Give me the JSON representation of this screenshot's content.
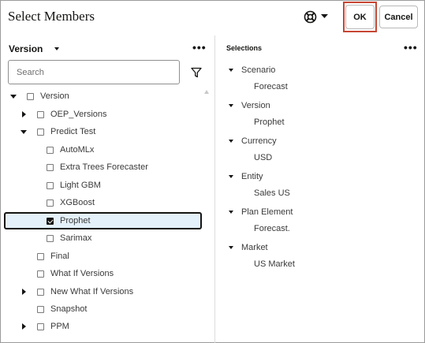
{
  "dialog": {
    "title": "Select Members",
    "ok_label": "OK",
    "cancel_label": "Cancel",
    "help_icon": "lifebuoy-icon",
    "help_caret_icon": "caret-down-icon"
  },
  "left": {
    "dimension_label": "Version",
    "more_label": "•••",
    "search_placeholder": "Search",
    "filter_icon": "filter-icon",
    "tree": [
      {
        "label": "Version",
        "toggle": "expanded",
        "checked": false
      },
      {
        "label": "OEP_Versions",
        "toggle": "collapsed",
        "checked": false
      },
      {
        "label": "Predict Test",
        "toggle": "expanded",
        "checked": false
      },
      {
        "label": "AutoMLx",
        "toggle": "none",
        "checked": false
      },
      {
        "label": "Extra Trees Forecaster",
        "toggle": "none",
        "checked": false
      },
      {
        "label": "Light GBM",
        "toggle": "none",
        "checked": false
      },
      {
        "label": "XGBoost",
        "toggle": "none",
        "checked": false
      },
      {
        "label": "Prophet",
        "toggle": "none",
        "checked": true
      },
      {
        "label": "Sarimax",
        "toggle": "none",
        "checked": false
      },
      {
        "label": "Final",
        "toggle": "none",
        "checked": false
      },
      {
        "label": "What If Versions",
        "toggle": "none",
        "checked": false
      },
      {
        "label": "New What If Versions",
        "toggle": "collapsed",
        "checked": false
      },
      {
        "label": "Snapshot",
        "toggle": "none",
        "checked": false
      },
      {
        "label": "PPM",
        "toggle": "collapsed",
        "checked": false
      }
    ]
  },
  "right": {
    "selections_label": "Selections",
    "more_label": "•••",
    "groups": [
      {
        "dimension": "Scenario",
        "member": "Forecast"
      },
      {
        "dimension": "Version",
        "member": "Prophet"
      },
      {
        "dimension": "Currency",
        "member": "USD"
      },
      {
        "dimension": "Entity",
        "member": "Sales US"
      },
      {
        "dimension": "Plan Element",
        "member": "Forecast."
      },
      {
        "dimension": "Market",
        "member": "US Market"
      }
    ]
  },
  "colors": {
    "highlight_red": "#c74634",
    "selected_row_bg": "#e4f1fb"
  }
}
